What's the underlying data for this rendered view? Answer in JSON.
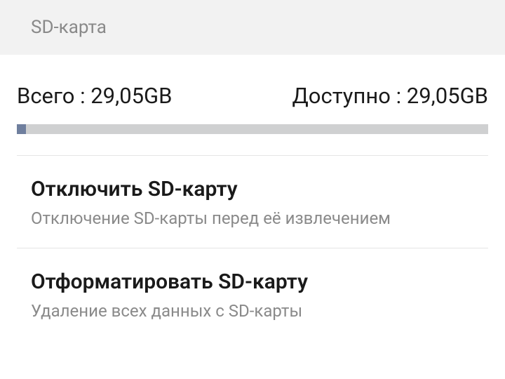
{
  "header": {
    "title": "SD-карта"
  },
  "storage": {
    "total_label": "Всего : 29,05GB",
    "available_label": "Доступно : 29,05GB",
    "progress_percent": 2
  },
  "items": [
    {
      "title": "Отключить SD-карту",
      "subtitle": "Отключение SD-карты перед её извлечением"
    },
    {
      "title": "Отформатировать SD-карту",
      "subtitle": "Удаление всех данных с SD-карты"
    }
  ]
}
